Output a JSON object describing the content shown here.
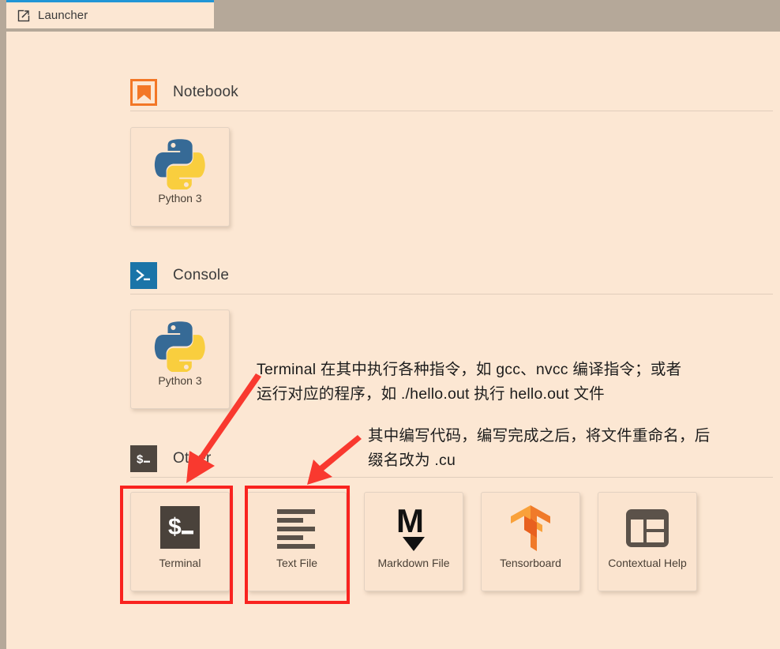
{
  "window": {
    "tab": {
      "label": "Launcher",
      "icon": "external-link-icon"
    }
  },
  "launcher": {
    "sections": [
      {
        "id": "notebook",
        "title": "Notebook",
        "icon": "jupyter-notebook-bookmark-icon",
        "cards": [
          {
            "label": "Python 3",
            "icon": "python-logo-icon"
          }
        ]
      },
      {
        "id": "console",
        "title": "Console",
        "icon": "console-prompt-icon",
        "cards": [
          {
            "label": "Python 3",
            "icon": "python-logo-icon"
          }
        ]
      },
      {
        "id": "other",
        "title": "Other",
        "icon": "terminal-dollar-icon",
        "cards": [
          {
            "label": "Terminal",
            "icon": "terminal-dollar-icon"
          },
          {
            "label": "Text File",
            "icon": "text-lines-icon"
          },
          {
            "label": "Markdown File",
            "icon": "markdown-m-icon"
          },
          {
            "label": "Tensorboard",
            "icon": "tensorflow-logo-icon"
          },
          {
            "label": "Contextual Help",
            "icon": "contextual-help-layout-icon"
          }
        ]
      }
    ]
  },
  "annotations": [
    {
      "id": "terminal-note",
      "text": "Terminal 在其中执行各种指令，如 gcc、nvcc 编译指令；或者\n运行对应的程序，如 ./hello.out 执行 hello.out 文件"
    },
    {
      "id": "textfile-note",
      "text": "其中编写代码，编写完成之后，将文件重命名，后\n缀名改为 .cu"
    }
  ],
  "highlights": [
    {
      "id": "terminal-card-highlight",
      "target": "Terminal"
    },
    {
      "id": "textfile-card-highlight",
      "target": "Text File"
    }
  ],
  "colors": {
    "accent_blue": "#2196d6",
    "panel_bg": "#fce7d3",
    "chrome_bg": "#b5a899",
    "notebook_orange": "#f37726",
    "console_blue": "#1a74a8",
    "terminal_dark": "#4e463f",
    "highlight_red": "#f9231f",
    "arrow_red": "#f9392f"
  }
}
